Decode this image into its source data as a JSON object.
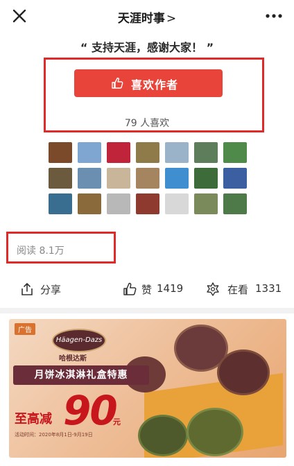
{
  "header": {
    "title": "天涯时事",
    "chevron": ">",
    "close_icon": "close-icon",
    "more_icon": "more-dots-icon"
  },
  "article": {
    "quote": "“ 支持天涯，感谢大家！ ”"
  },
  "like": {
    "button_label": "喜欢作者",
    "count_text": "79 人喜欢",
    "button_color": "#e8443a",
    "highlight_color": "#e02a2a"
  },
  "avatars": [
    {
      "color": "#7a4a2a"
    },
    {
      "color": "#7fa6d1"
    },
    {
      "color": "#c0243b"
    },
    {
      "color": "#8f7b4a"
    },
    {
      "color": "#9ab3c8"
    },
    {
      "color": "#5e7d5a"
    },
    {
      "color": "#4f8a4a"
    },
    {
      "color": "#6b5a3e"
    },
    {
      "color": "#6a8fb0"
    },
    {
      "color": "#c9b59a"
    },
    {
      "color": "#a58560"
    },
    {
      "color": "#3f8fd0"
    },
    {
      "color": "#3d6b3a"
    },
    {
      "color": "#3b5fa0"
    },
    {
      "color": "#3a6e90"
    },
    {
      "color": "#8a6a3a"
    },
    {
      "color": "#b8b8b8"
    },
    {
      "color": "#8e3a2e"
    },
    {
      "color": "#d8d8d8"
    },
    {
      "color": "#7a8a5a"
    },
    {
      "color": "#4e7a4a"
    }
  ],
  "stats": {
    "read_text": "阅读 8.1万"
  },
  "actions": {
    "share_label": "分享",
    "like_label": "赞",
    "like_count": "1419",
    "watch_label": "在看",
    "watch_count": "1331"
  },
  "ad": {
    "tag": "广告",
    "brand": "Häagen-Dazs",
    "brand_cn": "哈根达斯",
    "headline": "月饼冰淇淋礼盒特惠",
    "discount_prefix": "至高减",
    "discount_value": "90",
    "discount_unit": "元",
    "date_text": "活动时间：2020年8月1日-9月19日"
  }
}
